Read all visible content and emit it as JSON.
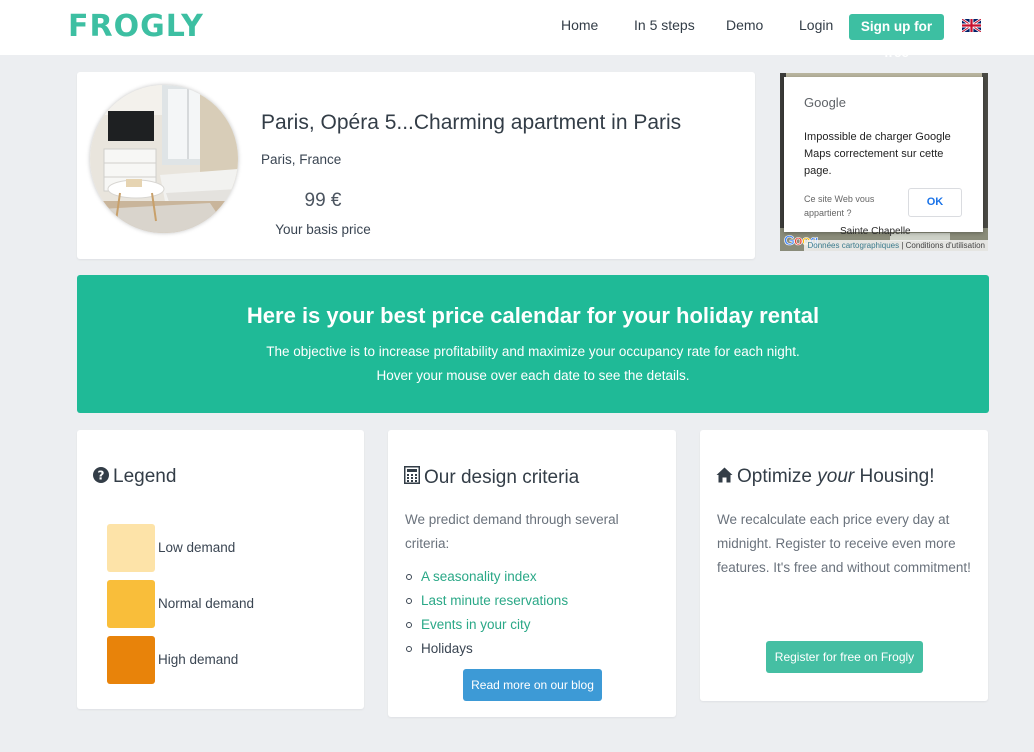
{
  "header": {
    "logo": "FROGLY",
    "nav": [
      "Home",
      "In 5 steps",
      "Demo",
      "Login"
    ],
    "signup_label": "Sign up for free",
    "language_icon": "uk-flag-icon"
  },
  "property": {
    "title": "Paris, Opéra 5...Charming apartment in Paris",
    "location": "Paris, France",
    "price": "99 €",
    "price_label": "Your basis price"
  },
  "map": {
    "brand": "Google",
    "error_message": "Impossible de charger Google Maps correctement sur cette page.",
    "owner_question": "Ce site Web vous appartient ?",
    "ok_label": "OK",
    "map_data_link": "Données cartographiques",
    "terms_link": "Conditions d'utilisation",
    "street_label": "Sainte Chapelle"
  },
  "banner": {
    "title": "Here is your best price calendar for your holiday rental",
    "line1": "The objective is to increase profitability and maximize your occupancy rate for each night.",
    "line2": "Hover your mouse over each date to see the details."
  },
  "legend": {
    "title": "Legend",
    "icon": "question-circle-icon",
    "items": [
      {
        "label": "Low demand",
        "color": "#fde3a8"
      },
      {
        "label": "Normal demand",
        "color": "#f9be3a"
      },
      {
        "label": "High demand",
        "color": "#e8830a"
      }
    ]
  },
  "criteria": {
    "title": "Our design criteria",
    "icon": "calculator-icon",
    "intro": "We predict demand through several criteria:",
    "items": [
      "A seasonality index",
      "Last minute reservations",
      "Events in your city",
      "Holidays"
    ],
    "blog_button": "Read more on our blog"
  },
  "optimize": {
    "title_pre": "Optimize ",
    "title_em": "your",
    "title_post": " Housing!",
    "icon": "home-icon",
    "text": "We recalculate each price every day at midnight. Register to receive even more features. It's free and without commitment!",
    "register_button": "Register for free on Frogly"
  },
  "colors": {
    "brand_green": "#3dbfa2",
    "banner_green": "#1fba97",
    "link_green": "#2aa887",
    "blog_blue": "#3d9ad6",
    "page_bg": "#eceef1"
  }
}
